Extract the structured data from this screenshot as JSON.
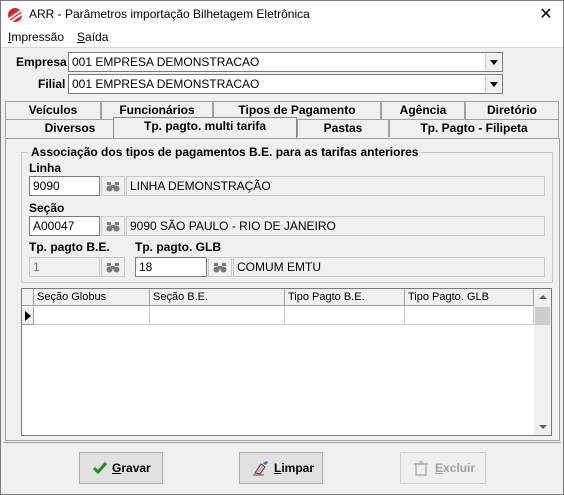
{
  "window": {
    "title": "ARR - Parâmetros importação Bilhetagem Eletrônica",
    "close": "✕"
  },
  "menu": [
    {
      "label": "Impressão",
      "mnemonic": "I",
      "rest": "mpressão"
    },
    {
      "label": "Saída",
      "mnemonic": "S",
      "rest": "aída"
    }
  ],
  "empresa": {
    "label": "Empresa",
    "value": "001 EMPRESA DEMONSTRACAO"
  },
  "filial": {
    "label": "Filial",
    "value": "001 EMPRESA DEMONSTRACAO"
  },
  "tabs_row1": [
    "Veículos",
    "Funcionários",
    "Tipos de Pagamento",
    "Agência",
    "Diretório"
  ],
  "tabs_row2": [
    "Diversos",
    "Tp. pagto. multi tarifa",
    "Pastas",
    "Tp. Pagto - Filipeta"
  ],
  "active_tab": "Tp. pagto. multi tarifa",
  "group": {
    "title": "Associação dos tipos de pagamentos B.E. para as tarifas anteriores",
    "linha": {
      "label": "Linha",
      "code": "9090",
      "desc": "LINHA DEMONSTRAÇÃO"
    },
    "secao": {
      "label": "Seção",
      "code": "A00047",
      "desc": "9090 SÃO PAULO - RIO DE JANEIRO"
    },
    "tp_pagto_be": {
      "label": "Tp. pagto B.E.",
      "code": "1"
    },
    "tp_pagto_glb": {
      "label": "Tp. pagto. GLB",
      "code": "18",
      "desc": "COMUM EMTU"
    }
  },
  "grid": {
    "columns": [
      "Seção Globus",
      "Seção B.E.",
      "Tipo Pagto B.E.",
      "Tipo Pagto. GLB"
    ]
  },
  "buttons": {
    "gravar": {
      "mnemonic": "G",
      "rest": "ravar"
    },
    "limpar": {
      "mnemonic": "L",
      "rest": "impar"
    },
    "excluir": {
      "mnemonic": "E",
      "rest": "xcluir"
    }
  },
  "colors": {
    "accent_green": "#1e8f1e",
    "disabled_gray": "#a0a0a0"
  }
}
